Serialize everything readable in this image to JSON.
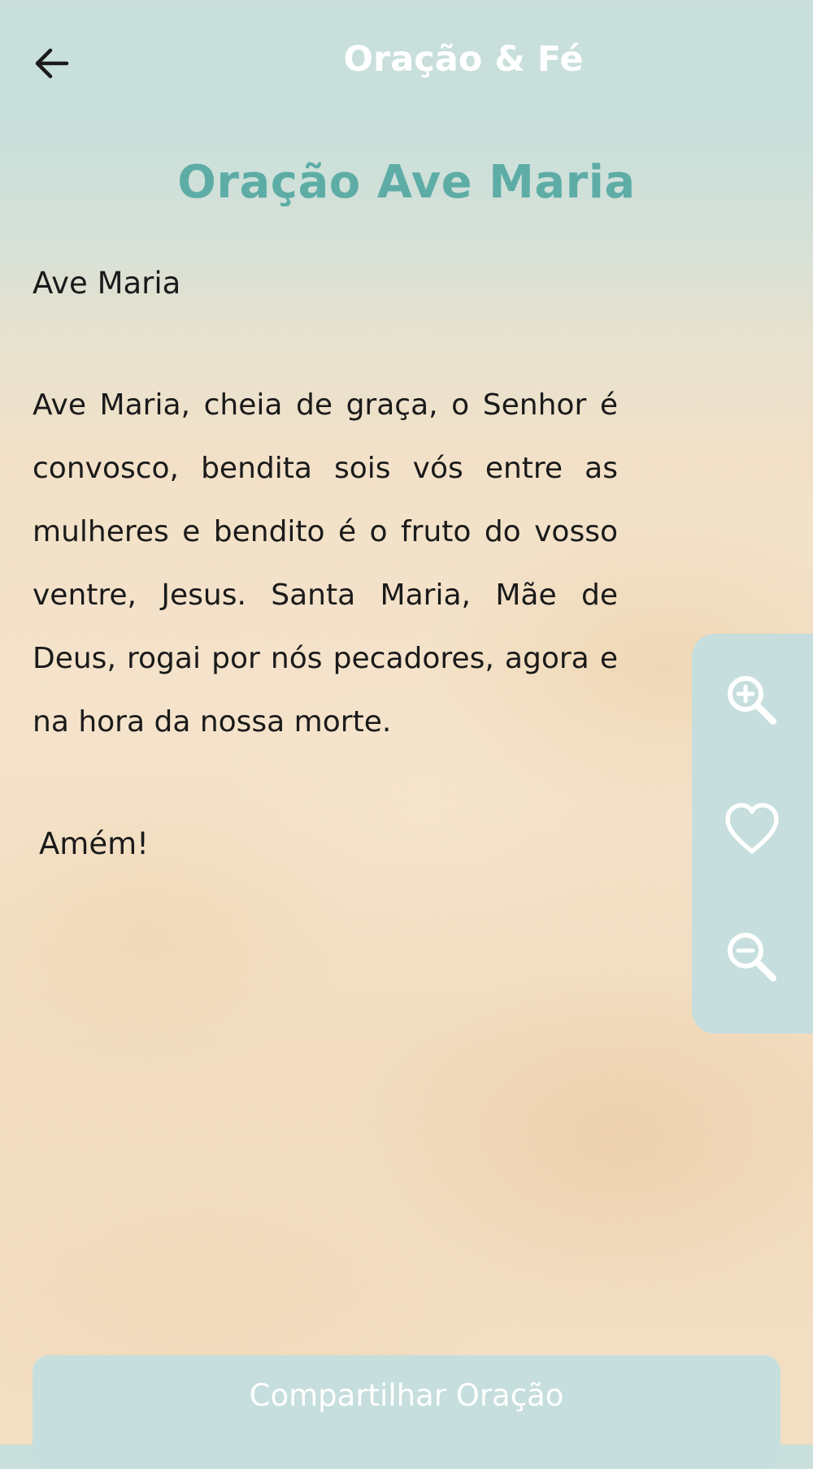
{
  "header": {
    "back_icon": "arrow-left-icon",
    "app_title": "Oração & Fé"
  },
  "prayer": {
    "title": "Oração Ave Maria",
    "heading": "Ave Maria",
    "body": "Ave Maria, cheia de graça, o Senhor é convosco, bendita sois vós entre as mulheres e bendito é o fruto do vosso ventre, Jesus. Santa Maria, Mãe de Deus, rogai por nós pecadores, agora e na hora da nossa morte.",
    "closing": "Amém!"
  },
  "side_panel": {
    "zoom_in_icon": "zoom-in-icon",
    "favorite_icon": "heart-outline-icon",
    "zoom_out_icon": "zoom-out-icon"
  },
  "share": {
    "label": "Compartilhar Oração"
  },
  "colors": {
    "accent_teal": "#5dada6",
    "panel": "#c6dedd",
    "text": "#1a1a1a"
  }
}
